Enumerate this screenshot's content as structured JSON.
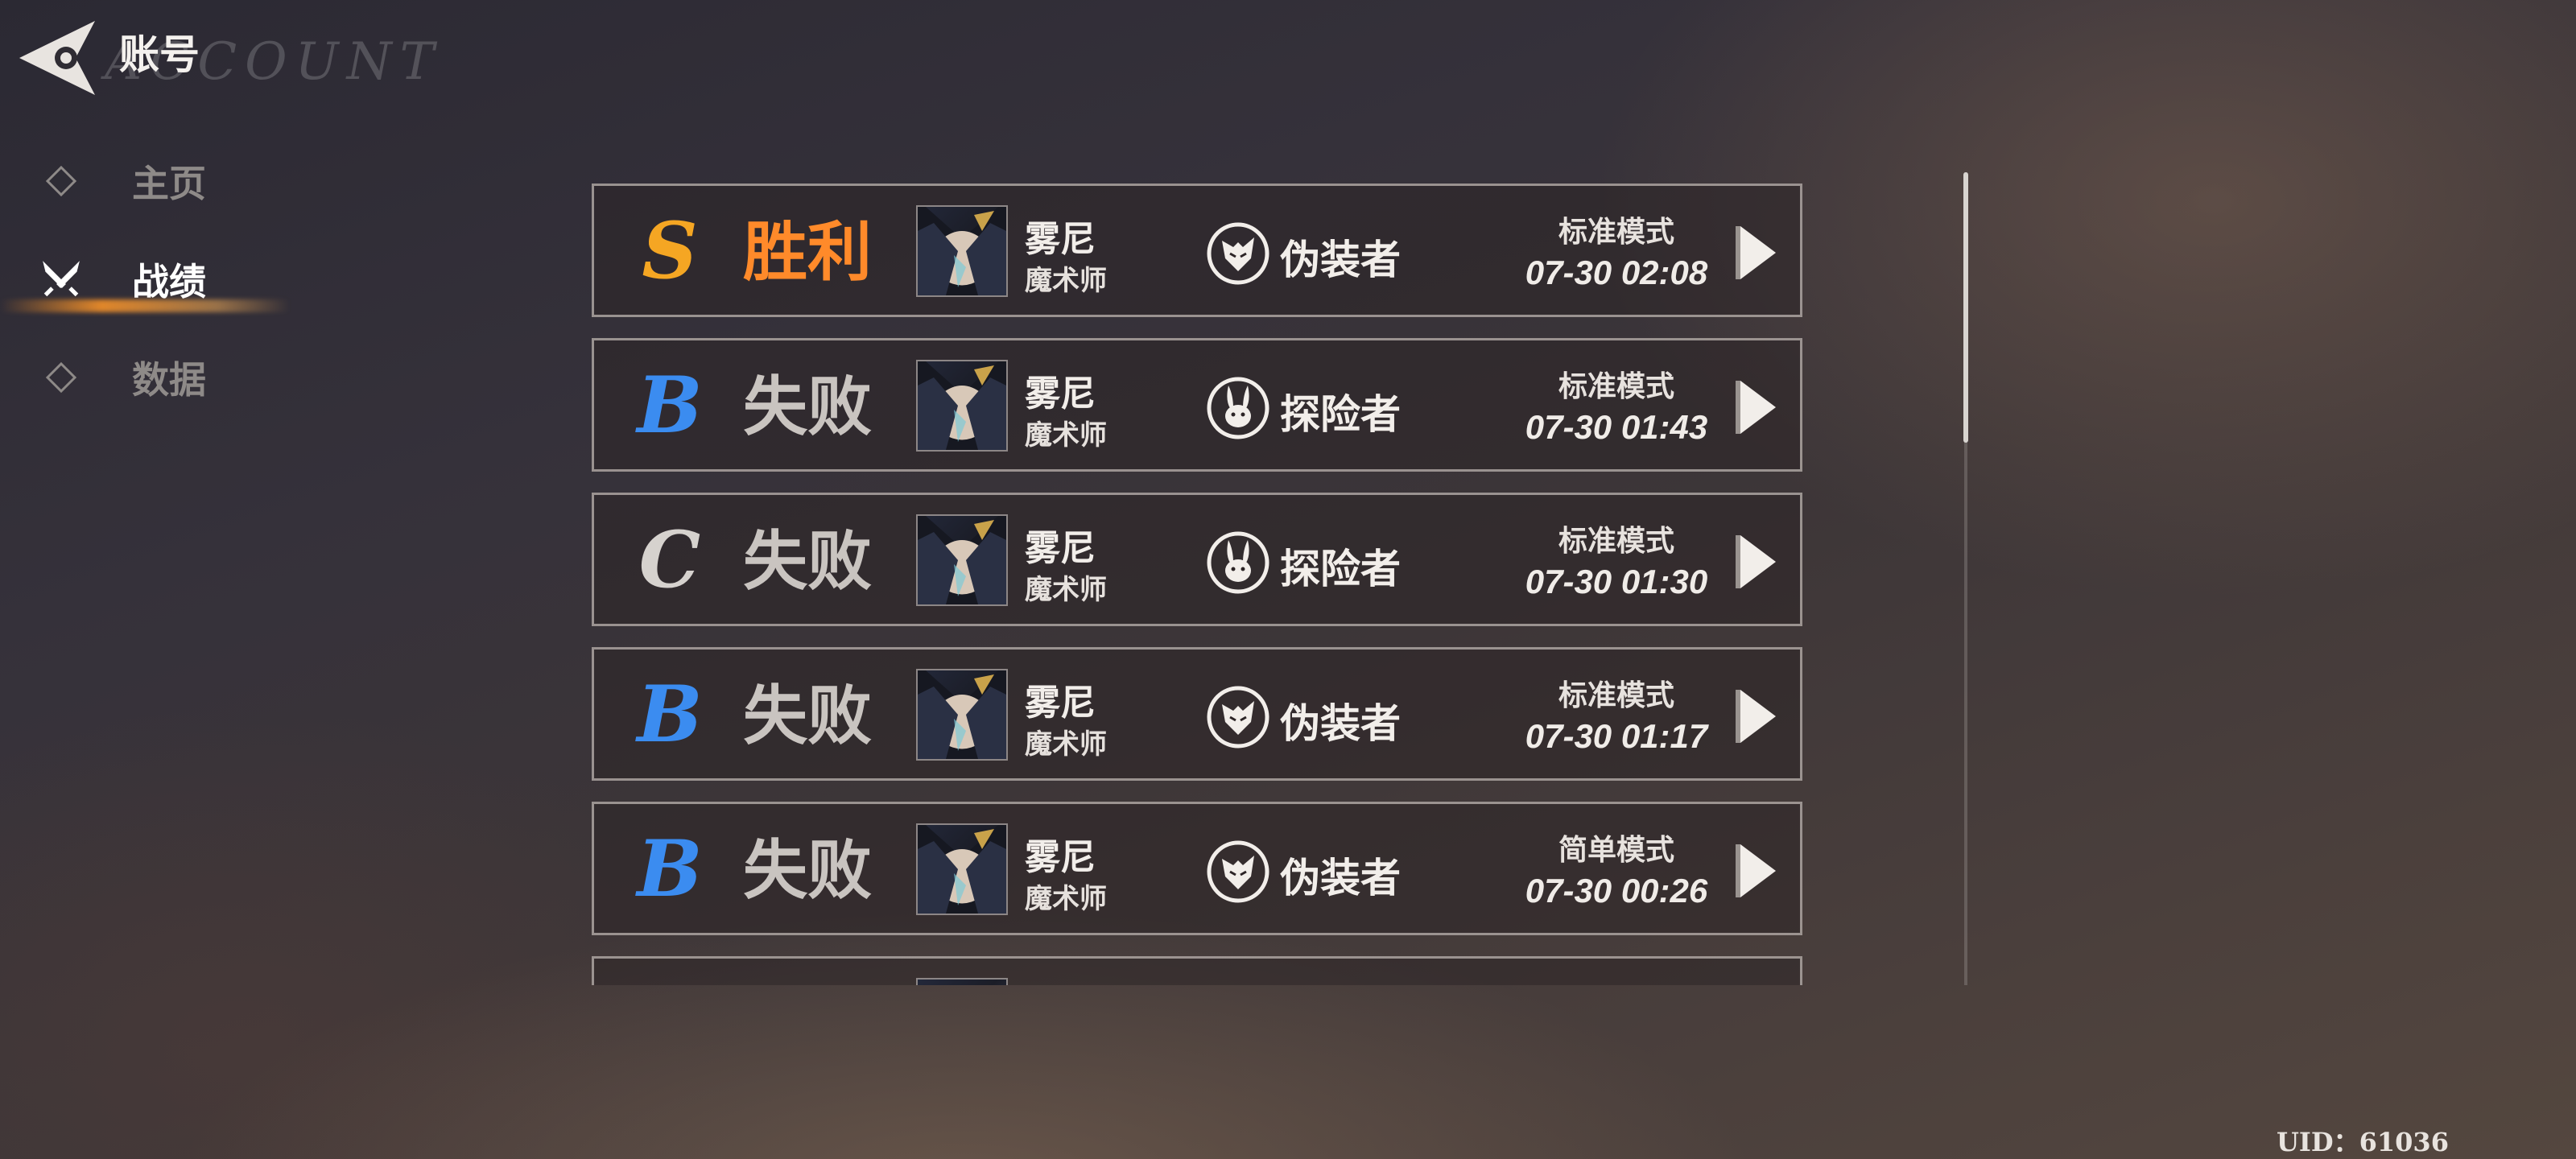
{
  "header": {
    "title": "账号",
    "watermark": "ACCOUNT"
  },
  "sidebar": {
    "items": [
      {
        "label": "主页",
        "active": false
      },
      {
        "label": "战绩",
        "active": true
      },
      {
        "label": "数据",
        "active": false
      }
    ]
  },
  "matches": [
    {
      "rank": "S",
      "rank_color": "#f5a623",
      "result": "胜利",
      "result_color": "#ff8a2a",
      "character": "雾尼",
      "class": "魔术师",
      "role_icon": "fox-mask-icon",
      "role": "伪装者",
      "mode": "标准模式",
      "time": "07-30 02:08"
    },
    {
      "rank": "B",
      "rank_color": "#3b8cf0",
      "result": "失败",
      "result_color": "#c9c4c0",
      "character": "雾尼",
      "class": "魔术师",
      "role_icon": "rabbit-icon",
      "role": "探险者",
      "mode": "标准模式",
      "time": "07-30 01:43"
    },
    {
      "rank": "C",
      "rank_color": "#d6d2ce",
      "result": "失败",
      "result_color": "#c9c4c0",
      "character": "雾尼",
      "class": "魔术师",
      "role_icon": "rabbit-icon",
      "role": "探险者",
      "mode": "标准模式",
      "time": "07-30 01:30"
    },
    {
      "rank": "B",
      "rank_color": "#3b8cf0",
      "result": "失败",
      "result_color": "#c9c4c0",
      "character": "雾尼",
      "class": "魔术师",
      "role_icon": "fox-mask-icon",
      "role": "伪装者",
      "mode": "标准模式",
      "time": "07-30 01:17"
    },
    {
      "rank": "B",
      "rank_color": "#3b8cf0",
      "result": "失败",
      "result_color": "#c9c4c0",
      "character": "雾尼",
      "class": "魔术师",
      "role_icon": "fox-mask-icon",
      "role": "伪装者",
      "mode": "简单模式",
      "time": "07-30 00:26"
    }
  ],
  "footer": {
    "uid": "UID：61036"
  }
}
